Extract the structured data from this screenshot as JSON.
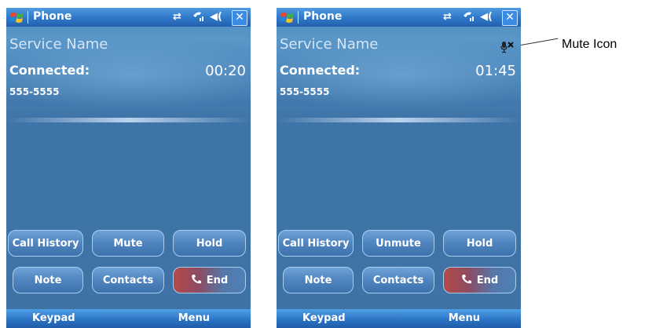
{
  "screens": [
    {
      "title": "Phone",
      "service_name": "Service Name",
      "status": "Connected:",
      "timer": "00:20",
      "number": "555-5555",
      "buttons": {
        "call_history": "Call History",
        "mute": "Mute",
        "hold": "Hold",
        "note": "Note",
        "contacts": "Contacts",
        "end": "End"
      },
      "softkeys": {
        "left": "Keypad",
        "right": "Menu"
      },
      "muted": false
    },
    {
      "title": "Phone",
      "service_name": "Service Name",
      "status": "Connected:",
      "timer": "01:45",
      "number": "555-5555",
      "buttons": {
        "call_history": "Call History",
        "mute": "Unmute",
        "hold": "Hold",
        "note": "Note",
        "contacts": "Contacts",
        "end": "End"
      },
      "softkeys": {
        "left": "Keypad",
        "right": "Menu"
      },
      "muted": true
    }
  ],
  "callout": {
    "label": "Mute Icon"
  },
  "icons": {
    "windows_flag": "windows-flag-icon",
    "connectivity": "connectivity-icon",
    "signal": "signal-icon",
    "volume": "speaker-icon",
    "close": "close-icon",
    "mute": "microphone-muted-icon",
    "end_phone": "phone-icon"
  },
  "colors": {
    "titlebar": "#2f77c8",
    "background": "#3f73a6",
    "end_button_red": "#b44a48"
  }
}
